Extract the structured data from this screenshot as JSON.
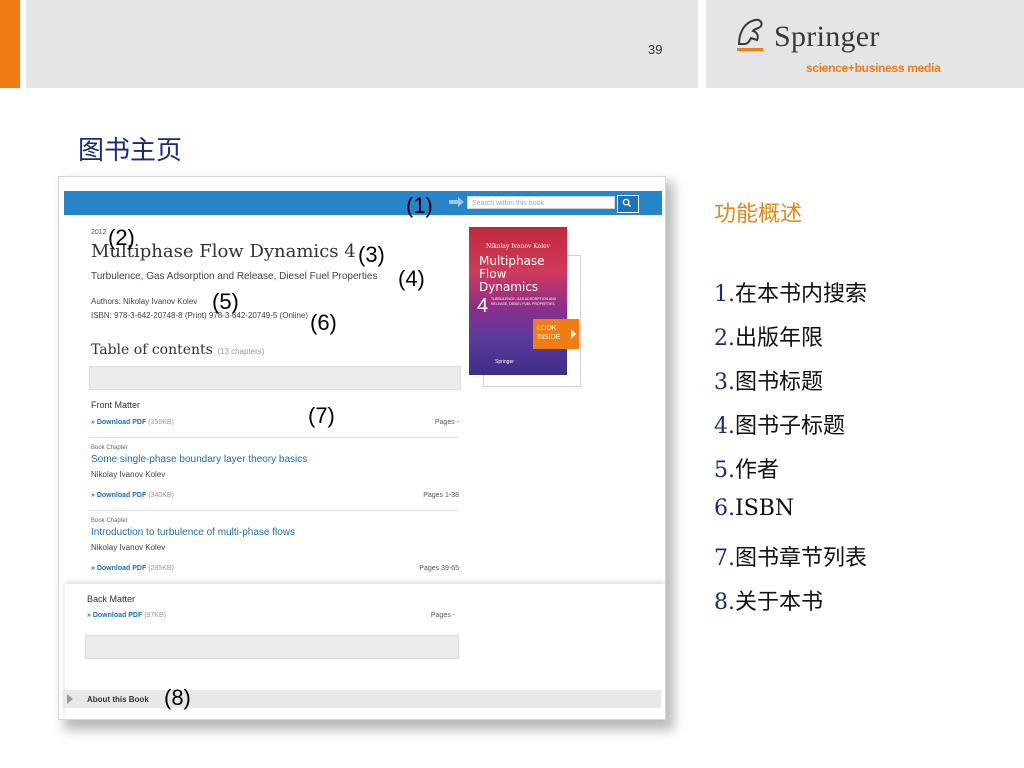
{
  "slide": {
    "page_number": "39",
    "title": "图书主页",
    "logo_name": "Springer",
    "logo_tag": "science+business media",
    "colors": {
      "accent_orange": "#f07d14",
      "header_gray": "#e4e5e7",
      "title_blue": "#1b2a7a",
      "feature_orange": "#e08a17"
    }
  },
  "screenshot": {
    "search_placeholder": "Search within this book",
    "year": "2012",
    "title": "Multiphase Flow Dynamics 4",
    "subtitle": "Turbulence, Gas Adsorption and Release, Diesel Fuel Properties",
    "authors": "Authors: Nikolay Ivanov Kolev",
    "isbn": "ISBN: 978-3-642-20748-8 (Print) 978-3-642-20749-5 (Online)",
    "toc_heading": "Table of contents",
    "toc_count": "(13 chapters)",
    "front_matter": {
      "label": "Front Matter",
      "download": "» Download PDF",
      "size": "(358KB)",
      "pages": "Pages -"
    },
    "chapters": [
      {
        "type": "Book Chapter",
        "title": "Some single-phase boundary layer theory basics",
        "author": "Nikolay Ivanov Kolev",
        "download": "» Download PDF",
        "size": "(340KB)",
        "pages": "Pages 1-38"
      },
      {
        "type": "Book Chapter",
        "title": "Introduction to turbulence of multi-phase flows",
        "author": "Nikolay Ivanov Kolev",
        "download": "» Download PDF",
        "size": "(285KB)",
        "pages": "Pages 39-65"
      }
    ],
    "back_matter": {
      "label": "Back Matter",
      "download": "» Download PDF",
      "size": "(97KB)",
      "pages": "Pages -"
    },
    "about_label": "About this Book",
    "cover": {
      "author": "Nikolay Ivanov Kolev",
      "title": "Multiphase Flow Dynamics",
      "volume": "4",
      "subtitle": "TURBULENCE, GAS ADSORPTION AND RELEASE, DIESEL FUEL PROPERTIES",
      "publisher": "Springer"
    },
    "look_inside": "LOOK INSIDE"
  },
  "annotations": [
    "(1)",
    "(2)",
    "(3)",
    "(4)",
    "(5)",
    "(6)",
    "(7)",
    "(8)"
  ],
  "features": {
    "title": "功能概述",
    "items": [
      {
        "num": "1.",
        "label": "在本书内搜索"
      },
      {
        "num": "2.",
        "label": "出版年限"
      },
      {
        "num": "3.",
        "label": "图书标题"
      },
      {
        "num": "4.",
        "label": "图书子标题"
      },
      {
        "num": "5.",
        "label": "作者"
      },
      {
        "num": "6.",
        "label": "ISBN"
      },
      {
        "num": "7.",
        "label": "图书章节列表"
      },
      {
        "num": "8.",
        "label": "关于本书"
      }
    ]
  }
}
